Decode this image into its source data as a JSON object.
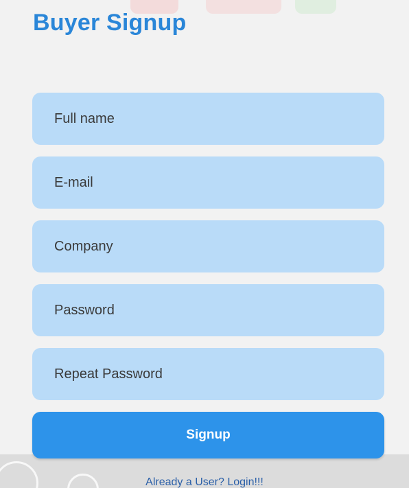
{
  "header": {
    "title": "Buyer Signup"
  },
  "form": {
    "fields": [
      {
        "placeholder": "Full name",
        "value": ""
      },
      {
        "placeholder": "E-mail",
        "value": ""
      },
      {
        "placeholder": "Company",
        "value": ""
      },
      {
        "placeholder": "Password",
        "value": ""
      },
      {
        "placeholder": "Repeat Password",
        "value": ""
      }
    ],
    "submit_label": "Signup"
  },
  "footer": {
    "login_link": "Already a User? Login!!!"
  },
  "colors": {
    "title": "#2a86d8",
    "field_bg": "#b9dbf8",
    "button_bg": "#2d93ea",
    "link": "#2a5fa8"
  }
}
